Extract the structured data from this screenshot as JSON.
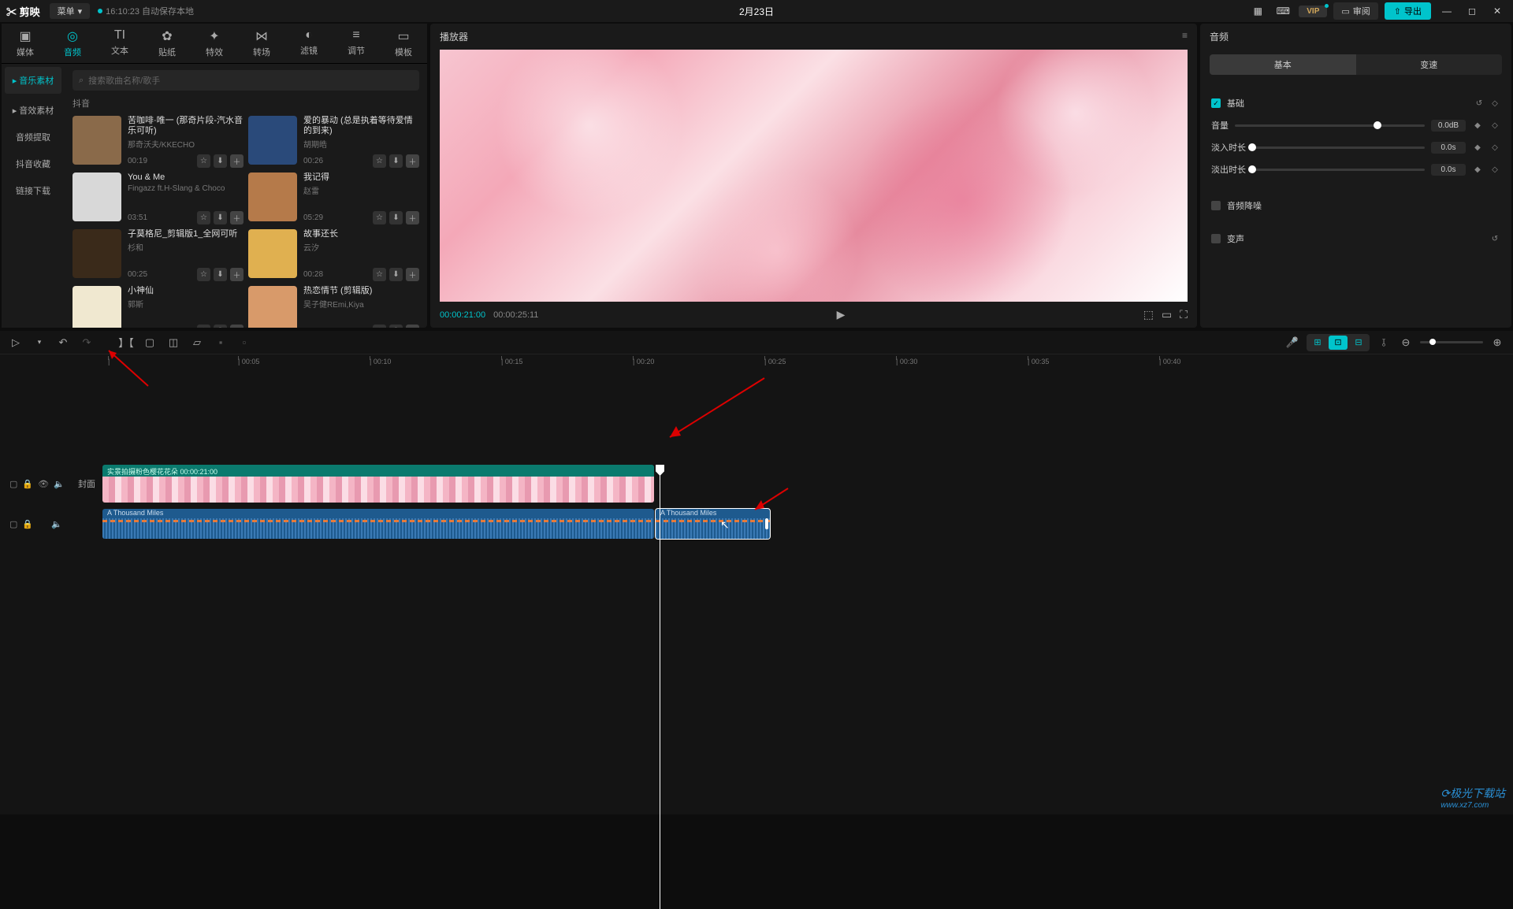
{
  "header": {
    "app": "剪映",
    "menu": "菜单",
    "autosave": "16:10:23 自动保存本地",
    "project": "2月23日",
    "vip": "VIP",
    "review": "审阅",
    "export": "导出"
  },
  "topTabs": [
    {
      "icon": "▣",
      "label": "媒体"
    },
    {
      "icon": "◎",
      "label": "音频"
    },
    {
      "icon": "TI",
      "label": "文本"
    },
    {
      "icon": "✿",
      "label": "贴纸"
    },
    {
      "icon": "✦",
      "label": "特效"
    },
    {
      "icon": "⋈",
      "label": "转场"
    },
    {
      "icon": "◐",
      "label": "滤镜"
    },
    {
      "icon": "≡",
      "label": "调节"
    },
    {
      "icon": "▭",
      "label": "模板"
    }
  ],
  "sideNav": [
    "音乐素材",
    "音效素材",
    "音频提取",
    "抖音收藏",
    "链接下载"
  ],
  "searchPlaceholder": "搜索歌曲名称/歌手",
  "sectionLabel": "抖音",
  "music": [
    {
      "title": "苦咖啡·唯一 (那奇片段-汽水音乐可听)",
      "artist": "那奇沃夫/KKECHO",
      "dur": "00:19",
      "bg": "#8a6a4a"
    },
    {
      "title": "爱的暴动 (总是执着等待爱情的到来)",
      "artist": "胡期皓",
      "dur": "00:26",
      "bg": "#2a4a7a"
    },
    {
      "title": "You & Me",
      "artist": "Fingazz ft.H-Slang & Choco",
      "dur": "03:51",
      "bg": "#d8d8d8"
    },
    {
      "title": "我记得",
      "artist": "赵雷",
      "dur": "05:29",
      "bg": "#b57a4a"
    },
    {
      "title": "子莫格尼_剪辑版1_全网可听",
      "artist": "杉和",
      "dur": "00:25",
      "bg": "#3a2a1a"
    },
    {
      "title": "故事还长",
      "artist": "云汐",
      "dur": "00:28",
      "bg": "#e0b050"
    },
    {
      "title": "小神仙",
      "artist": "郭斯",
      "dur": "",
      "bg": "#f0e8d0"
    },
    {
      "title": "热恋情节 (剪辑版)",
      "artist": "吴子健REmi,Kiya",
      "dur": "",
      "bg": "#d89a6a"
    }
  ],
  "player": {
    "title": "播放器",
    "current": "00:00:21:00",
    "total": "00:00:25:11"
  },
  "inspector": {
    "title": "音频",
    "tabs": [
      "基本",
      "变速"
    ],
    "basic": "基础",
    "volume": "音量",
    "volumeVal": "0.0dB",
    "fadeIn": "淡入时长",
    "fadeInVal": "0.0s",
    "fadeOut": "淡出时长",
    "fadeOutVal": "0.0s",
    "denoise": "音频降噪",
    "voiceChange": "变声"
  },
  "ruler": [
    "00:05",
    "00:10",
    "00:15",
    "00:20",
    "00:25",
    "00:30",
    "00:35",
    "00:40"
  ],
  "timeline": {
    "coverLabel": "封面",
    "videoClip": "实景拍摄粉色樱花花朵  00:00:21:00",
    "audioClip": "A Thousand Miles",
    "audioClip2": "A Thousand Miles"
  },
  "watermark": {
    "main": "极光下载站",
    "sub": "www.xz7.com"
  }
}
